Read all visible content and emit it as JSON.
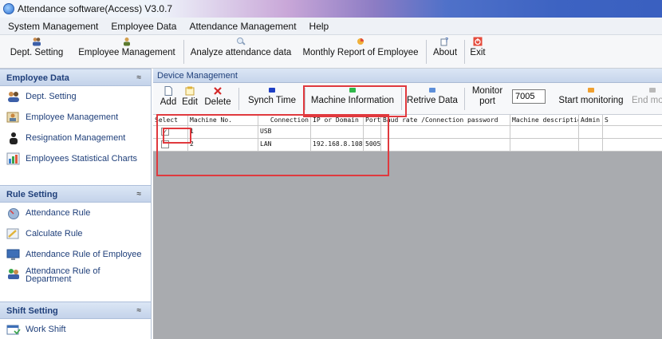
{
  "window": {
    "title": "Attendance software(Access) V3.0.7"
  },
  "menu": [
    "System Management",
    "Employee Data",
    "Attendance Management",
    "Help"
  ],
  "toolbar": {
    "dept_setting": "Dept. Setting",
    "employee_management": "Employee Management",
    "analyze": "Analyze attendance data",
    "monthly_report": "Monthly Report of Employee",
    "about": "About",
    "exit": "Exit"
  },
  "sidebar": {
    "employee_data": {
      "header": "Employee Data",
      "items": [
        "Dept. Setting",
        "Employee Management",
        "Resignation Management",
        "Employees Statistical Charts"
      ]
    },
    "rule_setting": {
      "header": "Rule Setting",
      "items": [
        "Attendance Rule",
        "Calculate Rule",
        "Attendance Rule of Employee",
        "Attendance Rule of",
        "Department"
      ]
    },
    "shift_setting": {
      "header": "Shift Setting",
      "items": [
        "Work Shift"
      ]
    },
    "collapse_glyph": "≈"
  },
  "device": {
    "title": "Device Management",
    "toolbar": {
      "add": "Add",
      "edit": "Edit",
      "delete": "Delete",
      "synch_time": "Synch Time",
      "machine_information": "Machine Information",
      "retrive_data": "Retrive Data",
      "monitor": "Monitor",
      "port": "port",
      "port_value": "7005",
      "start_monitoring": "Start monitoring",
      "end_monitoring": "End mor"
    },
    "columns": [
      "Select",
      "Machine No.",
      "Connection",
      "IP or Domain",
      "Port",
      "Baud rate /Connection password",
      "Machine description",
      "Admin",
      "S"
    ],
    "rows": [
      {
        "checked": true,
        "check_glyph": "✓",
        "machine_no": "1",
        "connection": "USB",
        "ip": "",
        "port": ""
      },
      {
        "checked": false,
        "check_glyph": "",
        "machine_no": "2",
        "connection": "LAN",
        "ip": "192.168.8.108",
        "port": "5005"
      }
    ]
  },
  "colors": {
    "highlight": "#e0393e",
    "panel_bg": "#a9abaf",
    "header_text": "#1f3f7a"
  }
}
